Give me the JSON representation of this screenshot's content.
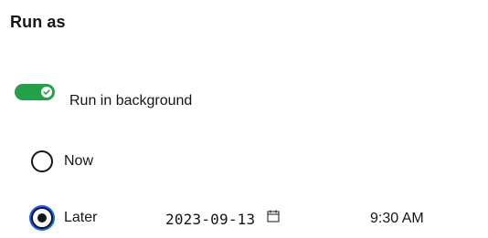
{
  "section": {
    "title": "Run as"
  },
  "toggle": {
    "label": "Run in background",
    "checked": true,
    "on_color": "#24a148"
  },
  "schedule": {
    "options": [
      {
        "label": "Now",
        "selected": false
      },
      {
        "label": "Later",
        "selected": true
      }
    ],
    "date": "2023-09-13",
    "time": "9:30 AM",
    "calendar_icon": "calendar-icon",
    "focus_color": "#0f62fe"
  }
}
